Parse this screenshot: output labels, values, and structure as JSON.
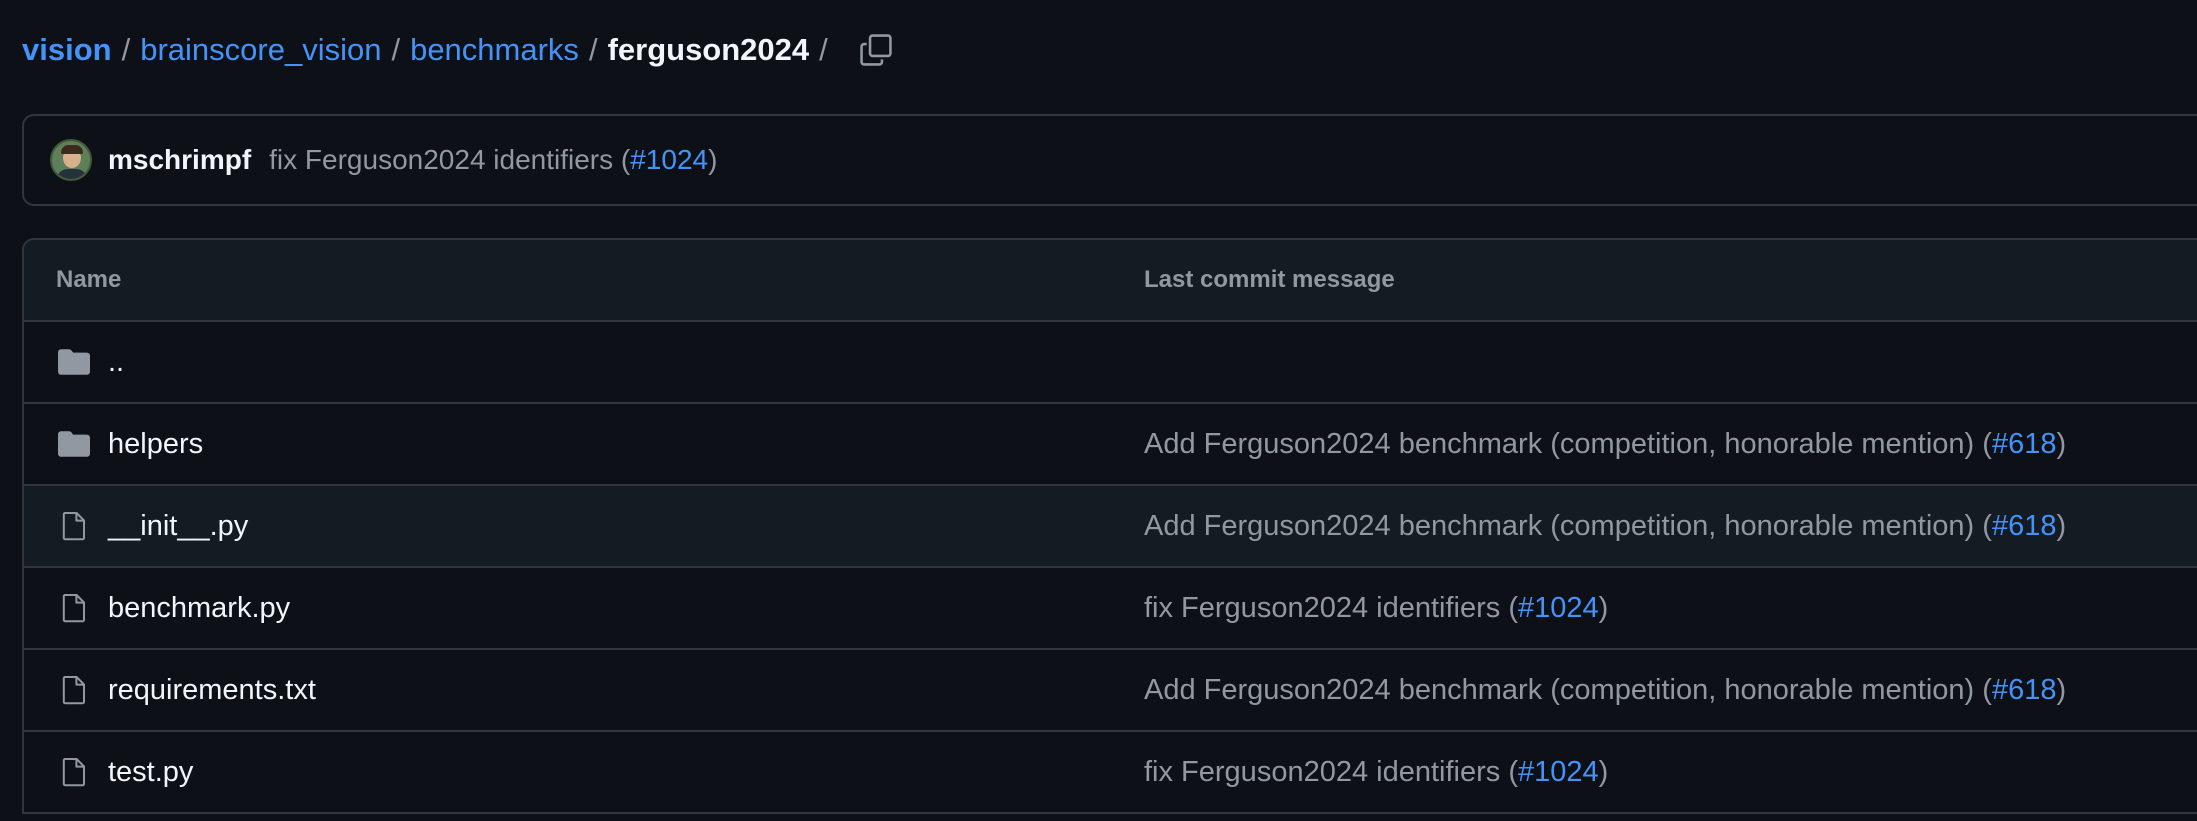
{
  "breadcrumb": {
    "root": "vision",
    "parts": [
      "brainscore_vision",
      "benchmarks"
    ],
    "current": "ferguson2024",
    "separator": "/"
  },
  "latest_commit": {
    "author": "mschrimpf",
    "message_prefix": "fix Ferguson2024 identifiers (",
    "pr_link": "#1024",
    "message_suffix": ")"
  },
  "table": {
    "headers": {
      "name": "Name",
      "message": "Last commit message"
    },
    "rows": [
      {
        "type": "folder",
        "name": "..",
        "msg_prefix": "",
        "pr": "",
        "msg_suffix": ""
      },
      {
        "type": "folder",
        "name": "helpers",
        "msg_prefix": "Add Ferguson2024 benchmark (competition, honorable mention) (",
        "pr": "#618",
        "msg_suffix": ")"
      },
      {
        "type": "file",
        "name": "__init__.py",
        "msg_prefix": "Add Ferguson2024 benchmark (competition, honorable mention) (",
        "pr": "#618",
        "msg_suffix": ")"
      },
      {
        "type": "file",
        "name": "benchmark.py",
        "msg_prefix": "fix Ferguson2024 identifiers (",
        "pr": "#1024",
        "msg_suffix": ")"
      },
      {
        "type": "file",
        "name": "requirements.txt",
        "msg_prefix": "Add Ferguson2024 benchmark (competition, honorable mention) (",
        "pr": "#618",
        "msg_suffix": ")"
      },
      {
        "type": "file",
        "name": "test.py",
        "msg_prefix": "fix Ferguson2024 identifiers (",
        "pr": "#1024",
        "msg_suffix": ")"
      }
    ]
  },
  "icons": {
    "copy": "copy-icon",
    "folder": "folder-icon",
    "file": "file-icon"
  },
  "colors": {
    "background": "#0d1117",
    "link": "#4493f8",
    "muted": "#9198a1",
    "border": "#30363d"
  }
}
